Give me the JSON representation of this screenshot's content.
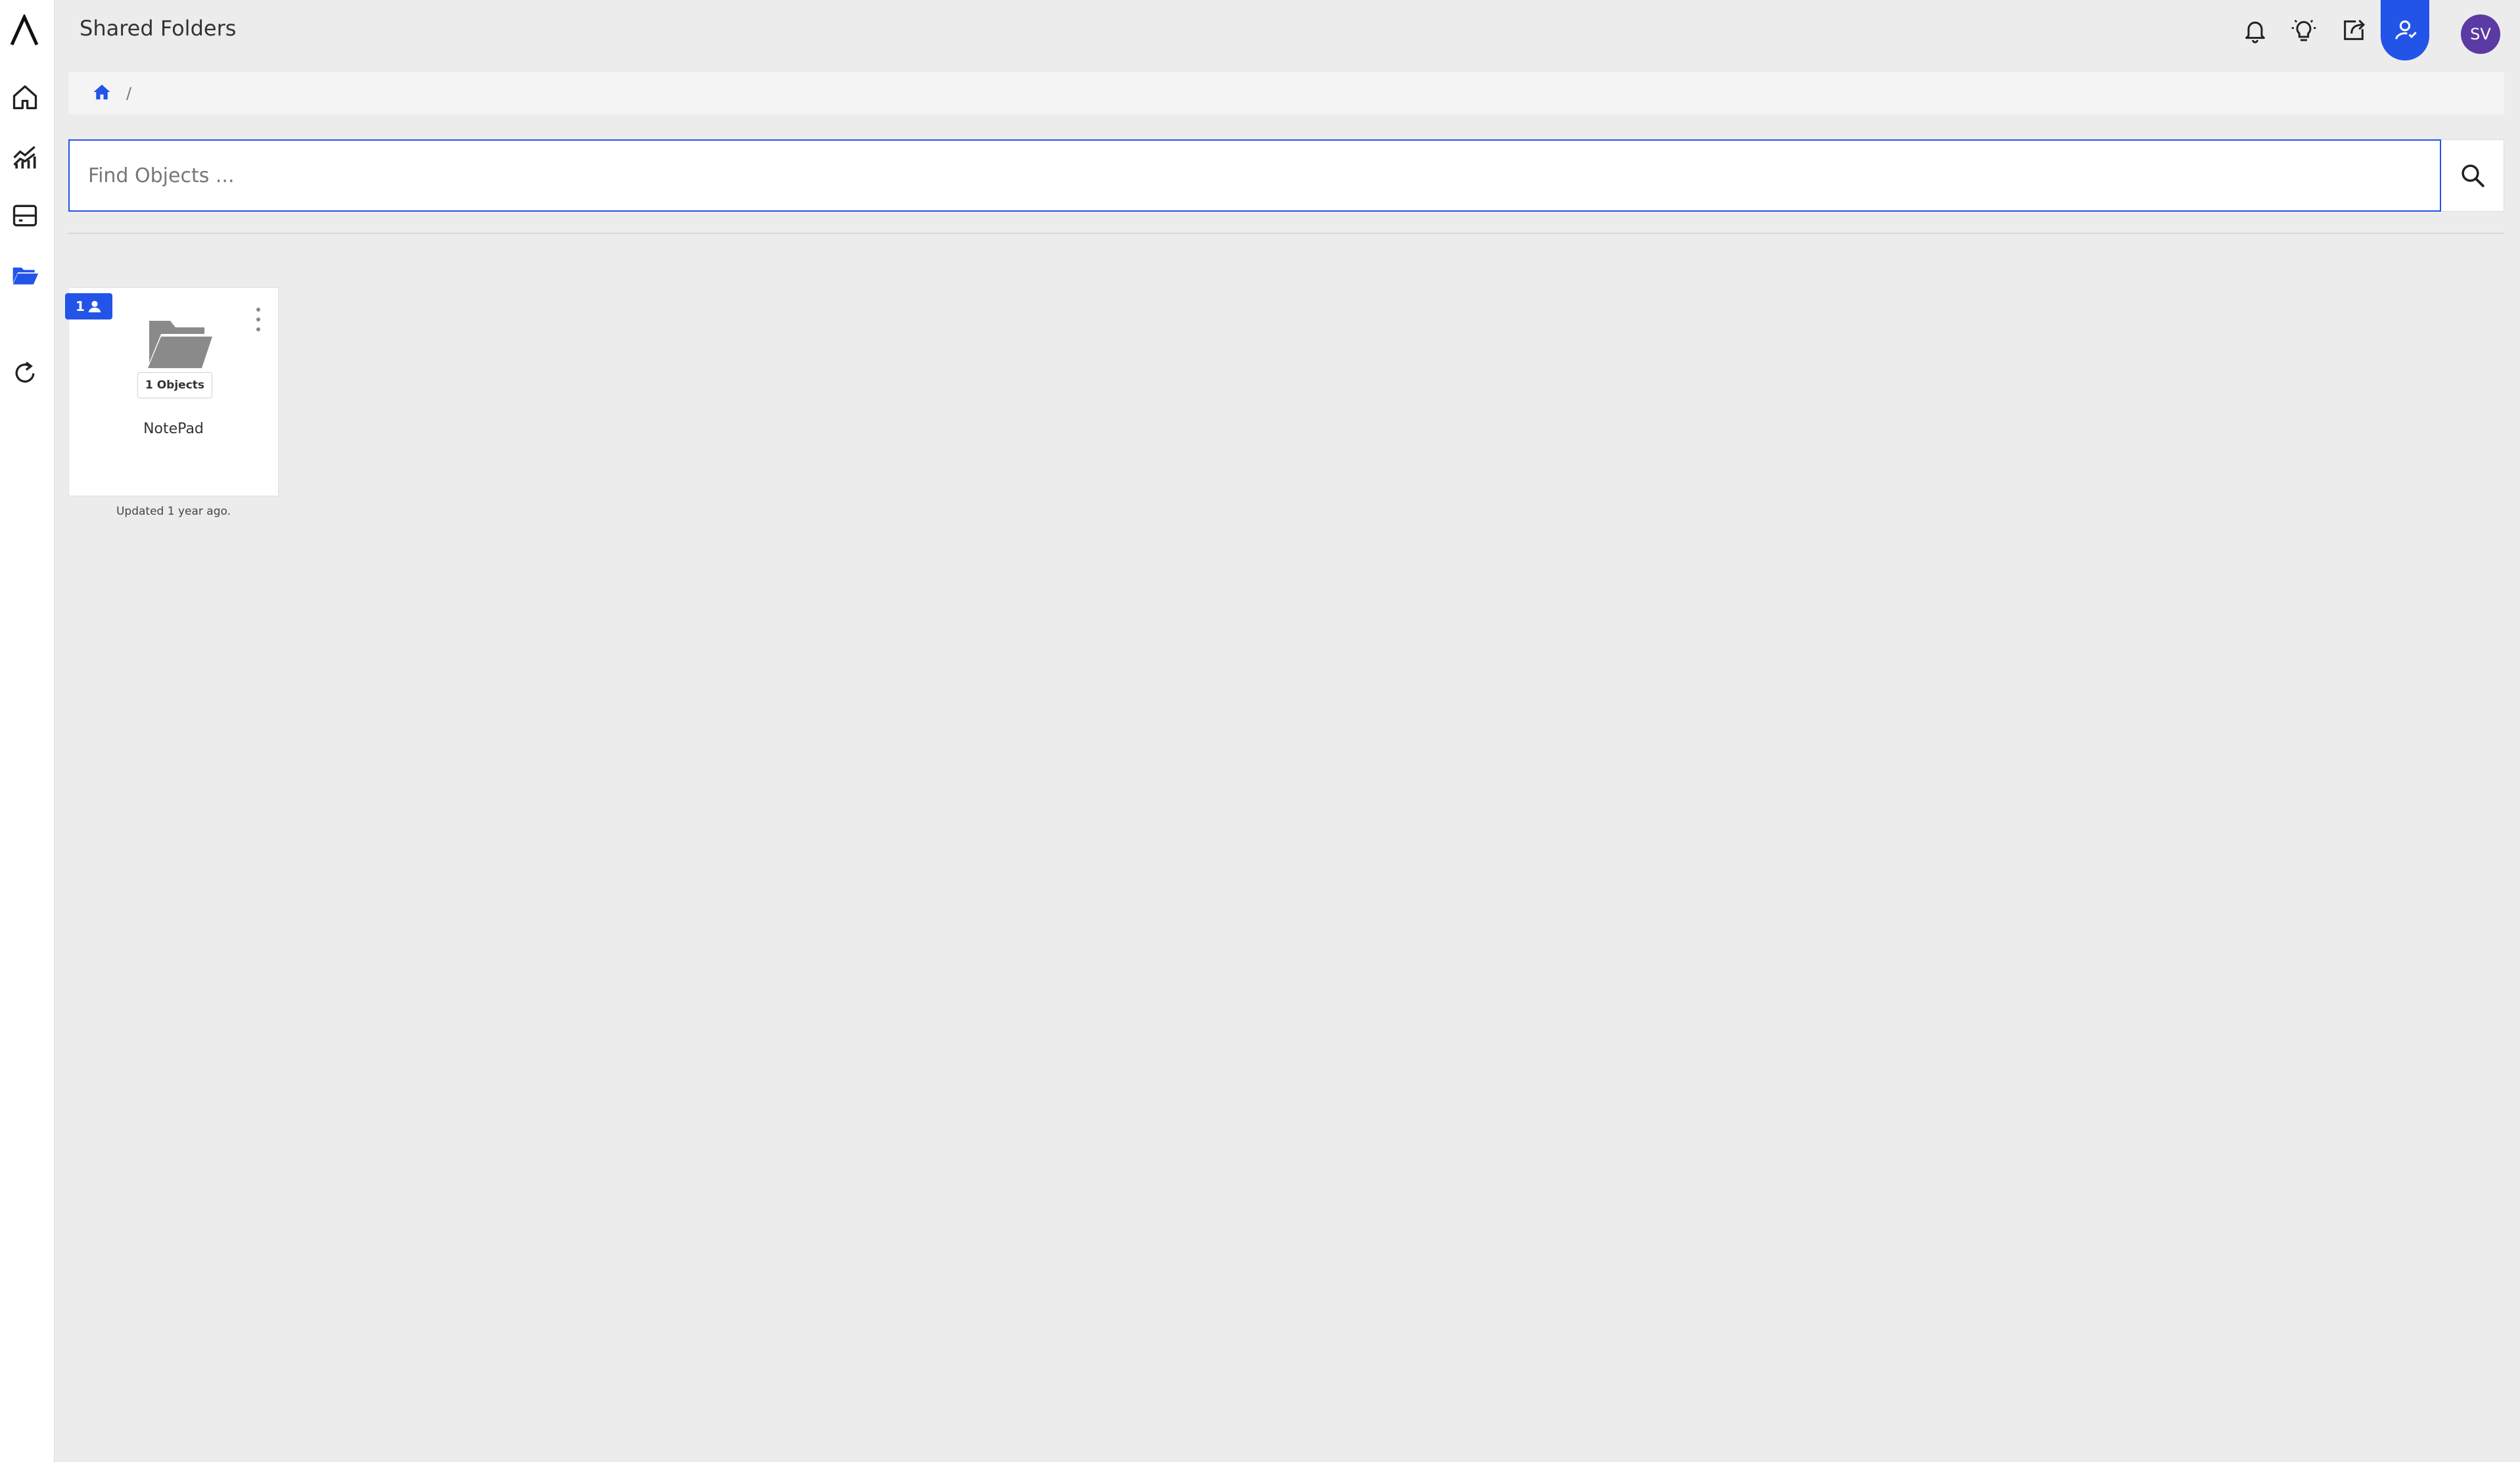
{
  "header": {
    "title": "Shared Folders",
    "avatar_initials": "SV"
  },
  "sidebar": {
    "items": [
      {
        "icon": "home-icon"
      },
      {
        "icon": "analytics-icon"
      },
      {
        "icon": "dashboard-icon"
      },
      {
        "icon": "folder-open-icon",
        "active": true
      },
      {
        "icon": "refresh-icon"
      }
    ]
  },
  "breadcrumb": {
    "separator": "/"
  },
  "search": {
    "placeholder": "Find Objects ..."
  },
  "folders": [
    {
      "name": "NotePad",
      "object_count_label": "1 Objects",
      "shared_count": "1",
      "updated": "Updated 1 year ago."
    }
  ],
  "colors": {
    "accent": "#2354e8",
    "avatar": "#5b3aa3",
    "folder": "#8a8a8a"
  }
}
